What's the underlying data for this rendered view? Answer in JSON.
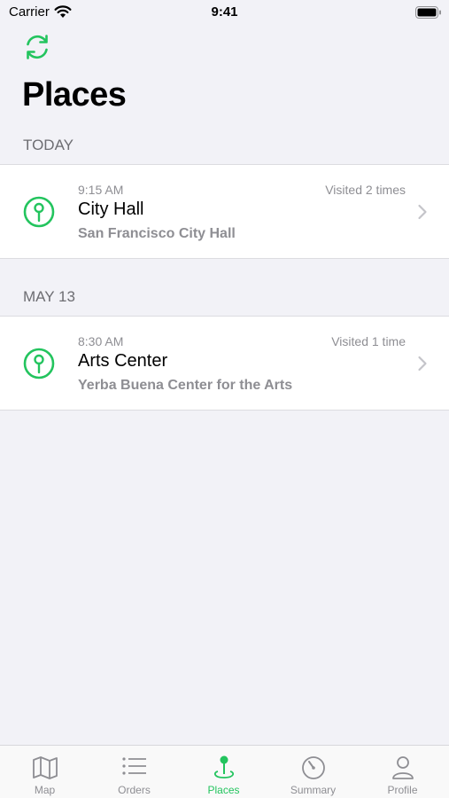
{
  "status_bar": {
    "carrier": "Carrier",
    "time": "9:41"
  },
  "page": {
    "title": "Places"
  },
  "sections": [
    {
      "header": "TODAY",
      "place": {
        "time": "9:15 AM",
        "visits": "Visited 2 times",
        "name": "City Hall",
        "address": "San Francisco City Hall"
      }
    },
    {
      "header": "MAY 13",
      "place": {
        "time": "8:30 AM",
        "visits": "Visited 1 time",
        "name": "Arts Center",
        "address": "Yerba Buena Center for the Arts"
      }
    }
  ],
  "tab_bar": {
    "tabs": [
      {
        "label": "Map",
        "icon": "map-icon",
        "active": false
      },
      {
        "label": "Orders",
        "icon": "list-icon",
        "active": false
      },
      {
        "label": "Places",
        "icon": "pin-icon",
        "active": true
      },
      {
        "label": "Summary",
        "icon": "gauge-icon",
        "active": false
      },
      {
        "label": "Profile",
        "icon": "person-icon",
        "active": false
      }
    ]
  },
  "colors": {
    "accent": "#23c45e",
    "secondary_text": "#8e8e93",
    "background": "#f2f2f7"
  }
}
